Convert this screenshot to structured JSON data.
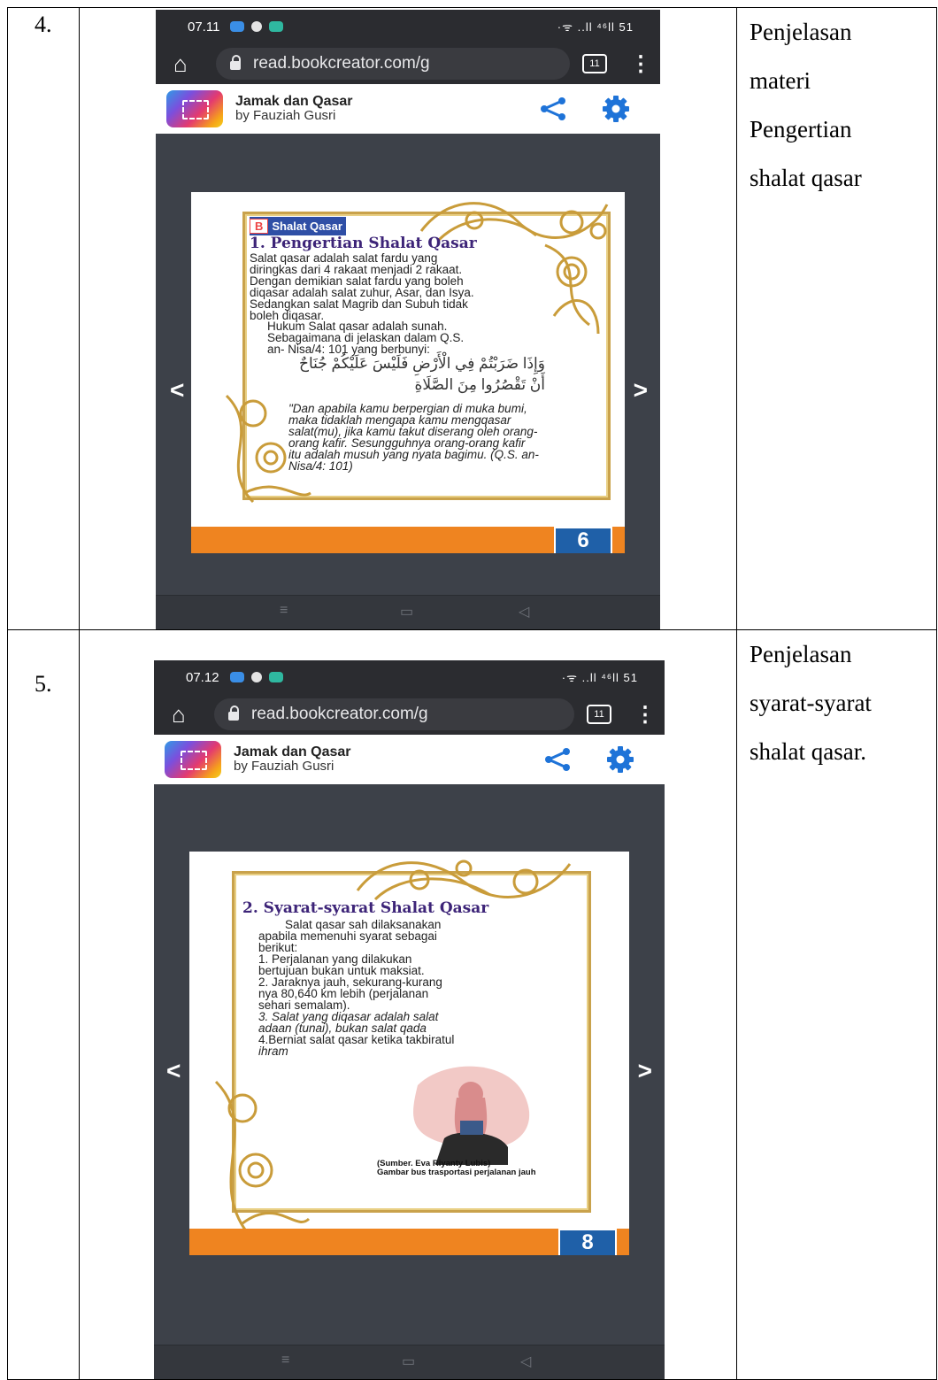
{
  "rows": [
    {
      "number": "4.",
      "description": [
        "Penjelasan",
        "materi",
        "Pengertian",
        "shalat qasar"
      ],
      "screenshot": {
        "status_time": "07.11",
        "status_right": "·ᯤ ..ll ⁴⁶ll 51",
        "url": "read.bookcreator.com/g",
        "tab_count": "11",
        "book_title": "Jamak dan Qasar",
        "book_author": "by Fauziah Gusri",
        "page_number": "6",
        "badge_letter": "B",
        "badge_text": "Shalat Qasar",
        "heading": "1. Pengertian Shalat Qasar",
        "paragraph1": [
          "Salat qasar adalah salat fardu yang",
          "diringkas dari 4 rakaat menjadi 2 rakaat.",
          "Dengan demikian salat fardu yang boleh",
          "diqasar adalah salat zuhur, Asar, dan Isya.",
          "Sedangkan salat Magrib dan Subuh tidak",
          "boleh diqasar."
        ],
        "paragraph2": [
          "Hukum Salat qasar adalah sunah.",
          "Sebagaimana di jelaskan dalam Q.S.",
          "an- Nisa/4: 101 yang berbunyi:"
        ],
        "arabic": [
          "وَإِذَا ضَرَبْتُمْ فِي الْأَرْضِ فَلَيْسَ عَلَيْكُمْ جُنَاحٌ",
          "أَنْ تَقْصُرُوا مِنَ الصَّلَاةِ"
        ],
        "quote": [
          "\"Dan apabila kamu berpergian di muka bumi,",
          "maka tidaklah mengapa kamu mengqasar",
          "salat(mu), jika kamu takut diserang oleh orang-",
          "orang kafir. Sesungguhnya orang-orang kafir",
          "itu adalah musuh yang nyata bagimu. (Q.S. an-",
          "Nisa/4: 101)"
        ]
      }
    },
    {
      "number": "5.",
      "description": [
        "Penjelasan",
        "syarat-syarat",
        "shalat qasar."
      ],
      "screenshot": {
        "status_time": "07.12",
        "status_right": "·ᯤ ..ll ⁴⁶ll 51",
        "url": "read.bookcreator.com/g",
        "tab_count": "11",
        "book_title": "Jamak dan Qasar",
        "book_author": "by Fauziah Gusri",
        "page_number": "8",
        "heading": "2. Syarat-syarat Shalat Qasar",
        "body": [
          "Salat qasar sah dilaksanakan",
          "apabila memenuhi syarat sebagai",
          "berikut:",
          "1. Perjalanan yang dilakukan",
          "bertujuan bukan untuk maksiat.",
          "2. Jaraknya jauh, sekurang-kurang",
          "nya 80,640 km lebih (perjalanan",
          "sehari semalam).",
          "3. Salat yang diqasar adalah salat",
          "adaan (tunai), bukan salat qada",
          "4.Berniat salat qasar ketika takbiratul",
          "ihram"
        ],
        "credit": [
          "(Sumber. Eva Riyanty Lubis)",
          "Gambar bus trasportasi perjalanan jauh"
        ]
      }
    }
  ]
}
